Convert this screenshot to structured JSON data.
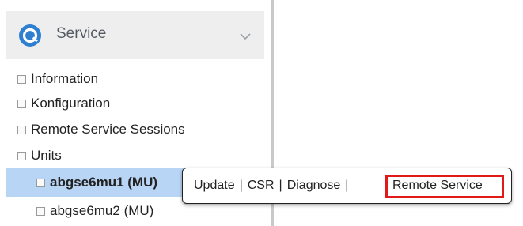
{
  "header": {
    "title": "Service"
  },
  "tree": {
    "items": [
      {
        "label": "Information"
      },
      {
        "label": "Konfiguration"
      },
      {
        "label": "Remote Service Sessions"
      },
      {
        "label": "Units"
      }
    ],
    "units": [
      {
        "label": "abgse6mu1 (MU)",
        "selected": true
      },
      {
        "label": "abgse6mu2 (MU)",
        "selected": false
      }
    ]
  },
  "popup": {
    "links": [
      {
        "label": "Update"
      },
      {
        "label": "CSR"
      },
      {
        "label": "Diagnose"
      },
      {
        "label": "Remote Service"
      }
    ],
    "separator": "|"
  },
  "colors": {
    "header_bg": "#eeeeee",
    "icon_blue": "#2f7fd1",
    "selected_bg": "#b9d5f5",
    "highlight_red": "#e11919"
  },
  "icons": [
    "service-icon",
    "chevron-down-icon"
  ]
}
